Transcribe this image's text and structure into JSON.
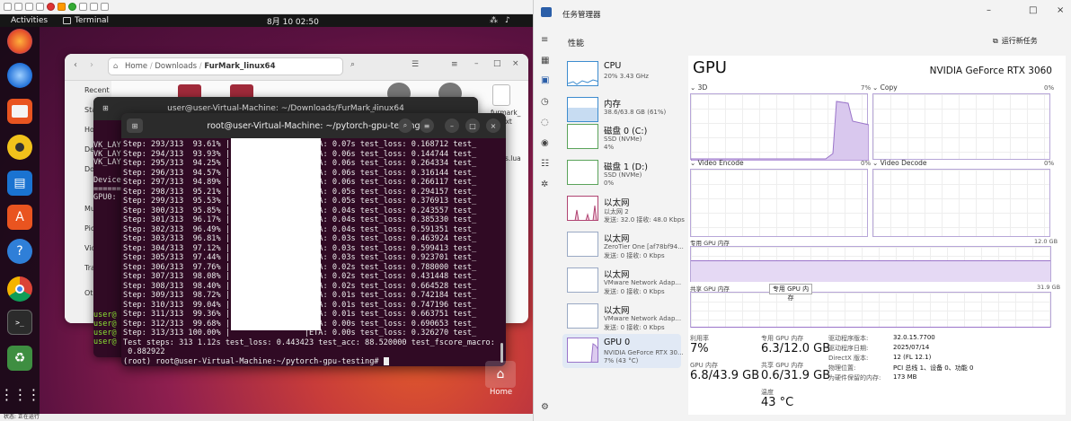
{
  "vm": {
    "topbar": {
      "activities": "Activities",
      "app": "Terminal",
      "clock": "8月 10  02:50"
    },
    "status": "状态: 正在运行",
    "files": {
      "path": [
        "Home",
        "Downloads",
        "FurMark_linux64"
      ],
      "sidebar": [
        "Recent",
        "Sta",
        "Ho",
        "De",
        "Do",
        "Mu",
        "Pic",
        "Vid",
        "Tra",
        "Ot"
      ],
      "items": [
        "furmark_",
        "ext",
        "s.lua"
      ]
    },
    "term_back": {
      "title": "user@user-Virtual-Machine: ~/Downloads/FurMark_linux64",
      "lines": [
        "VK_LAY",
        "VK_LAY",
        "VK_LAY",
        "",
        "Device",
        "======",
        "GPU0:"
      ],
      "prompts": [
        "user@",
        "user@",
        "user@",
        "user@"
      ]
    },
    "term_front": {
      "title": "root@user-Virtual-Machine: ~/pytorch-gpu-testing",
      "lines": [
        "Step: 293/313  93.61% |                |ETA: 0.07s test_loss: 0.168712 test_",
        "Step: 294/313  93.93% |                |ETA: 0.06s test_loss: 0.144744 test_",
        "Step: 295/313  94.25% |                |ETA: 0.06s test_loss: 0.264334 test_",
        "Step: 296/313  94.57% |                |ETA: 0.06s test_loss: 0.316144 test_",
        "Step: 297/313  94.89% |                |ETA: 0.06s test_loss: 0.266117 test_",
        "Step: 298/313  95.21% |                |ETA: 0.05s test_loss: 0.294157 test_",
        "Step: 299/313  95.53% |                |ETA: 0.05s test_loss: 0.376913 test_",
        "Step: 300/313  95.85% |                |ETA: 0.04s test_loss: 0.243557 test_",
        "Step: 301/313  96.17% |                |ETA: 0.04s test_loss: 0.385330 test_",
        "Step: 302/313  96.49% |                |ETA: 0.04s test_loss: 0.591351 test_",
        "Step: 303/313  96.81% |                |ETA: 0.03s test_loss: 0.463924 test_",
        "Step: 304/313  97.12% |                |ETA: 0.03s test_loss: 0.599413 test_",
        "Step: 305/313  97.44% |                |ETA: 0.03s test_loss: 0.923701 test_",
        "Step: 306/313  97.76% |                |ETA: 0.02s test_loss: 0.788000 test_",
        "Step: 307/313  98.08% |                |ETA: 0.02s test_loss: 0.431448 test_",
        "Step: 308/313  98.40% |                |ETA: 0.02s test_loss: 0.664528 test_",
        "Step: 309/313  98.72% |                |ETA: 0.01s test_loss: 0.742184 test_",
        "Step: 310/313  99.04% |                |ETA: 0.01s test_loss: 0.747196 test_",
        "Step: 311/313  99.36% |                |ETA: 0.01s test_loss: 0.663751 test_",
        "Step: 312/313  99.68% |                |ETA: 0.00s test_loss: 0.690653 test_",
        "Step: 313/313 100.00% |                |ETA: 0.00s test_loss: 0.326270 test_",
        "Test steps: 313 1.12s test_loss: 0.443423 test_acc: 88.520000 test_fscore_macro:",
        " 0.882922"
      ],
      "prompt": "(root) root@user-Virtual-Machine:~/pytorch-gpu-testing# "
    },
    "desktop_home": "Home"
  },
  "tm": {
    "title": "任务管理器",
    "section": "性能",
    "run_task": "运行新任务",
    "processes": [
      {
        "name": "CPU",
        "sub1": "20%  3.43 GHz",
        "sub2": ""
      },
      {
        "name": "内存",
        "sub1": "38.6/63.8 GB (61%)",
        "sub2": ""
      },
      {
        "name": "磁盘 0 (C:)",
        "sub1": "SSD (NVMe)",
        "sub2": "4%"
      },
      {
        "name": "磁盘 1 (D:)",
        "sub1": "SSD (NVMe)",
        "sub2": "0%"
      },
      {
        "name": "以太网",
        "sub1": "以太网 2",
        "sub2": "发送: 32.0 接收: 48.0 Kbps"
      },
      {
        "name": "以太网",
        "sub1": "ZeroTier One [af78bf94...",
        "sub2": "发送: 0 接收: 0 Kbps"
      },
      {
        "name": "以太网",
        "sub1": "VMware Network Adap...",
        "sub2": "发送: 0 接收: 0 Kbps"
      },
      {
        "name": "以太网",
        "sub1": "VMware Network Adap...",
        "sub2": "发送: 0 接收: 0 Kbps"
      },
      {
        "name": "GPU 0",
        "sub1": "NVIDIA GeForce RTX 30...",
        "sub2": "7% (43 °C)"
      }
    ],
    "gpu": {
      "title": "GPU",
      "model": "NVIDIA GeForce RTX 3060",
      "g3d": {
        "label": "3D",
        "pct": "7%"
      },
      "gcopy": {
        "label": "Copy",
        "pct": "0%"
      },
      "genc": {
        "label": "Video Encode",
        "pct": "0%"
      },
      "gdec": {
        "label": "Video Decode",
        "pct": "0%"
      },
      "dedicated": {
        "label": "专用 GPU 内存",
        "max": "12.0 GB"
      },
      "shared": {
        "label": "共享 GPU 内存",
        "max": "31.9 GB"
      },
      "tooltip": "专用 GPU 内存",
      "stats": {
        "util_lbl": "利用率",
        "util": "7%",
        "ded_lbl": "专用 GPU 内存",
        "ded": "6.3/12.0 GB",
        "gmem_lbl": "GPU 内存",
        "gmem": "6.8/43.9 GB",
        "sh_lbl": "共享 GPU 内存",
        "sh": "0.6/31.9 GB",
        "temp_lbl": "温度",
        "temp": "43 °C"
      },
      "kv": [
        [
          "驱动程序版本:",
          "32.0.15.7700"
        ],
        [
          "驱动程序日期:",
          "2025/07/14"
        ],
        [
          "DirectX 版本:",
          "12 (FL 12.1)"
        ],
        [
          "物理位置:",
          "PCI 总线 1、设备 0、功能 0"
        ],
        [
          "为硬件保留的内存:",
          "173 MB"
        ]
      ]
    }
  }
}
